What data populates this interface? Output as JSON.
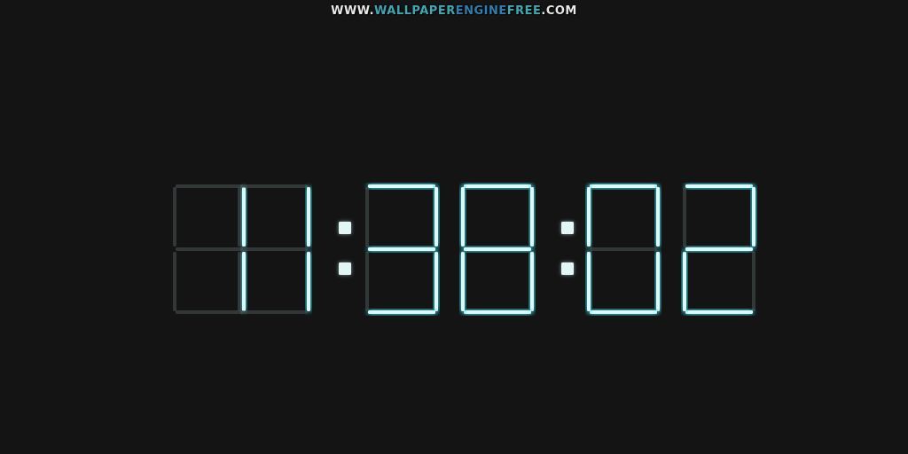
{
  "watermark": {
    "prefix": "WWW.",
    "part1": "WALLPAPER",
    "part2": "ENGINE",
    "part3": "FREE",
    "suffix": ".COM"
  },
  "clock": {
    "time_text": "11:38:02",
    "hours": "11",
    "minutes": "38",
    "seconds": "02",
    "digits": [
      "1",
      "1",
      "3",
      "8",
      "0",
      "2"
    ],
    "lit_color": "#d9fbfb",
    "glow_color": "#3fc9d6",
    "unlit_color": "#4a5454",
    "background": "#141414"
  }
}
